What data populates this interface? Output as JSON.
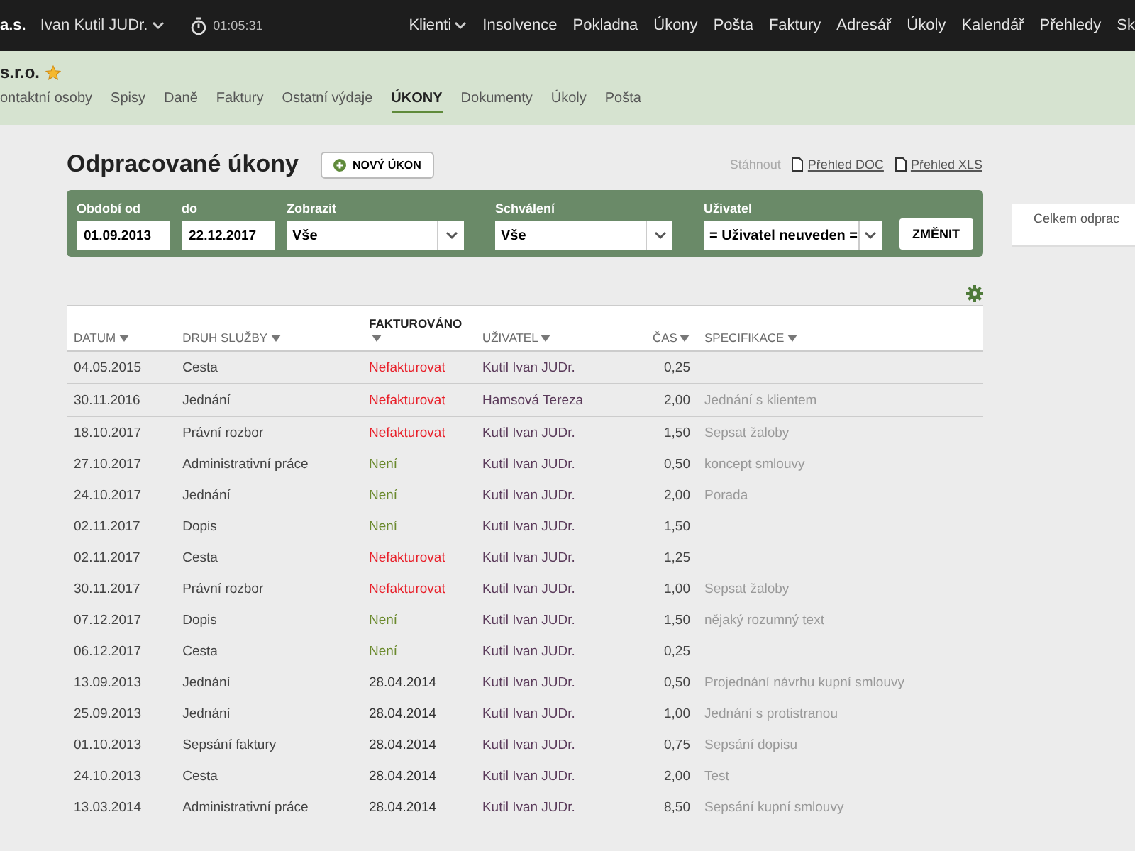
{
  "topbar": {
    "company": "a.s.",
    "user": "Ivan Kutil JUDr.",
    "timer": "01:05:31",
    "nav": [
      {
        "label": "Klienti",
        "dropdown": true
      },
      {
        "label": "Insolvence",
        "dropdown": false
      },
      {
        "label": "Pokladna",
        "dropdown": false
      },
      {
        "label": "Úkony",
        "dropdown": false
      },
      {
        "label": "Pošta",
        "dropdown": false
      },
      {
        "label": "Faktury",
        "dropdown": false
      },
      {
        "label": "Adresář",
        "dropdown": false
      },
      {
        "label": "Úkoly",
        "dropdown": false
      },
      {
        "label": "Kalendář",
        "dropdown": false
      },
      {
        "label": "Přehledy",
        "dropdown": false
      },
      {
        "label": "Sk",
        "dropdown": false
      }
    ]
  },
  "client": {
    "name": "s.r.o.",
    "favorite": true,
    "tabs": [
      {
        "label": "ontaktní osoby",
        "selected": false
      },
      {
        "label": "Spisy",
        "selected": false
      },
      {
        "label": "Daně",
        "selected": false
      },
      {
        "label": "Faktury",
        "selected": false
      },
      {
        "label": "Ostatní výdaje",
        "selected": false
      },
      {
        "label": "ÚKONY",
        "selected": true
      },
      {
        "label": "Dokumenty",
        "selected": false
      },
      {
        "label": "Úkoly",
        "selected": false
      },
      {
        "label": "Pošta",
        "selected": false
      }
    ]
  },
  "page": {
    "title": "Odpracované úkony",
    "new_button": "NOVÝ ÚKON",
    "download_label": "Stáhnout",
    "downloads": [
      "Přehled DOC",
      "Přehled XLS"
    ]
  },
  "filters": [
    {
      "kind": "input",
      "label": "Období od",
      "value": "01.09.2013"
    },
    {
      "kind": "input",
      "label": "do",
      "value": "22.12.2017"
    },
    {
      "kind": "select",
      "label": "Zobrazit",
      "value": "Vše"
    },
    {
      "kind": "select",
      "label": "Schválení",
      "value": "Vše"
    },
    {
      "kind": "select",
      "label": "Uživatel",
      "value": "= Uživatel neuveden ="
    }
  ],
  "apply_button": "ZMĚNIT",
  "summary": {
    "text": "Celkem odprac"
  },
  "table": {
    "columns": [
      {
        "label": "DATUM",
        "sortable": true
      },
      {
        "label": "DRUH SLUŽBY",
        "sortable": true
      },
      {
        "label": "FAKTUROVÁNO",
        "sortable": true
      },
      {
        "label": "UŽIVATEL",
        "sortable": true
      },
      {
        "label": "ČAS",
        "sortable": true
      },
      {
        "label": "SPECIFIKACE",
        "sortable": true
      }
    ],
    "rows": [
      {
        "date": "04.05.2015",
        "service": "Cesta",
        "billed": {
          "kind": "unbilled",
          "text": "Nefakturovat"
        },
        "user": "Kutil Ivan JUDr.",
        "time": "0,25"
      },
      {
        "date": "30.11.2016",
        "service": "Jednání",
        "billed": {
          "kind": "unbilled",
          "text": "Nefakturovat"
        },
        "user": "Hamsová Tereza",
        "time": "2,00",
        "spec": "Jednání s klientem"
      },
      {
        "date": "18.10.2017",
        "service": "Právní rozbor",
        "billed": {
          "kind": "unbilled",
          "text": "Nefakturovat"
        },
        "user": "Kutil Ivan JUDr.",
        "time": "1,50",
        "spec": "Sepsat žaloby"
      },
      {
        "date": "27.10.2017",
        "service": "Administrativní práce",
        "billed": {
          "kind": "pending",
          "text": "Není"
        },
        "user": "Kutil Ivan JUDr.",
        "time": "0,50",
        "spec": "koncept smlouvy"
      },
      {
        "date": "24.10.2017",
        "service": "Jednání",
        "billed": {
          "kind": "pending",
          "text": "Není"
        },
        "user": "Kutil Ivan JUDr.",
        "time": "2,00",
        "spec": "Porada"
      },
      {
        "date": "02.11.2017",
        "service": "Dopis",
        "billed": {
          "kind": "pending",
          "text": "Není"
        },
        "user": "Kutil Ivan JUDr.",
        "time": "1,50"
      },
      {
        "date": "02.11.2017",
        "service": "Cesta",
        "billed": {
          "kind": "unbilled",
          "text": "Nefakturovat"
        },
        "user": "Kutil Ivan JUDr.",
        "time": "1,25"
      },
      {
        "date": "30.11.2017",
        "service": "Právní rozbor",
        "billed": {
          "kind": "unbilled",
          "text": "Nefakturovat"
        },
        "user": "Kutil Ivan JUDr.",
        "time": "1,00",
        "spec": "Sepsat žaloby"
      },
      {
        "date": "07.12.2017",
        "service": "Dopis",
        "billed": {
          "kind": "pending",
          "text": "Není"
        },
        "user": "Kutil Ivan JUDr.",
        "time": "1,50",
        "spec": "nějaký rozumný text"
      },
      {
        "date": "06.12.2017",
        "service": "Cesta",
        "billed": {
          "kind": "pending",
          "text": "Není"
        },
        "user": "Kutil Ivan JUDr.",
        "time": "0,25"
      },
      {
        "date": "13.09.2013",
        "service": "Jednání",
        "billed": {
          "kind": "date",
          "text": "28.04.2014"
        },
        "user": "Kutil Ivan JUDr.",
        "time": "0,50",
        "spec": "Projednání návrhu kupní smlouvy"
      },
      {
        "date": "25.09.2013",
        "service": "Jednání",
        "billed": {
          "kind": "date",
          "text": "28.04.2014"
        },
        "user": "Kutil Ivan JUDr.",
        "time": "1,00",
        "spec": "Jednání s protistranou"
      },
      {
        "date": "01.10.2013",
        "service": "Sepsání faktury",
        "billed": {
          "kind": "date",
          "text": "28.04.2014"
        },
        "user": "Kutil Ivan JUDr.",
        "time": "0,75",
        "spec": "Sepsání dopisu"
      },
      {
        "date": "24.10.2013",
        "service": "Cesta",
        "billed": {
          "kind": "date",
          "text": "28.04.2014"
        },
        "user": "Kutil Ivan JUDr.",
        "time": "2,00",
        "spec": "Test"
      },
      {
        "date": "13.03.2014",
        "service": "Administrativní práce",
        "billed": {
          "kind": "date",
          "text": "28.04.2014"
        },
        "user": "Kutil Ivan JUDr.",
        "time": "8,50",
        "spec": "Sepsání kupní smlouvy"
      }
    ]
  }
}
